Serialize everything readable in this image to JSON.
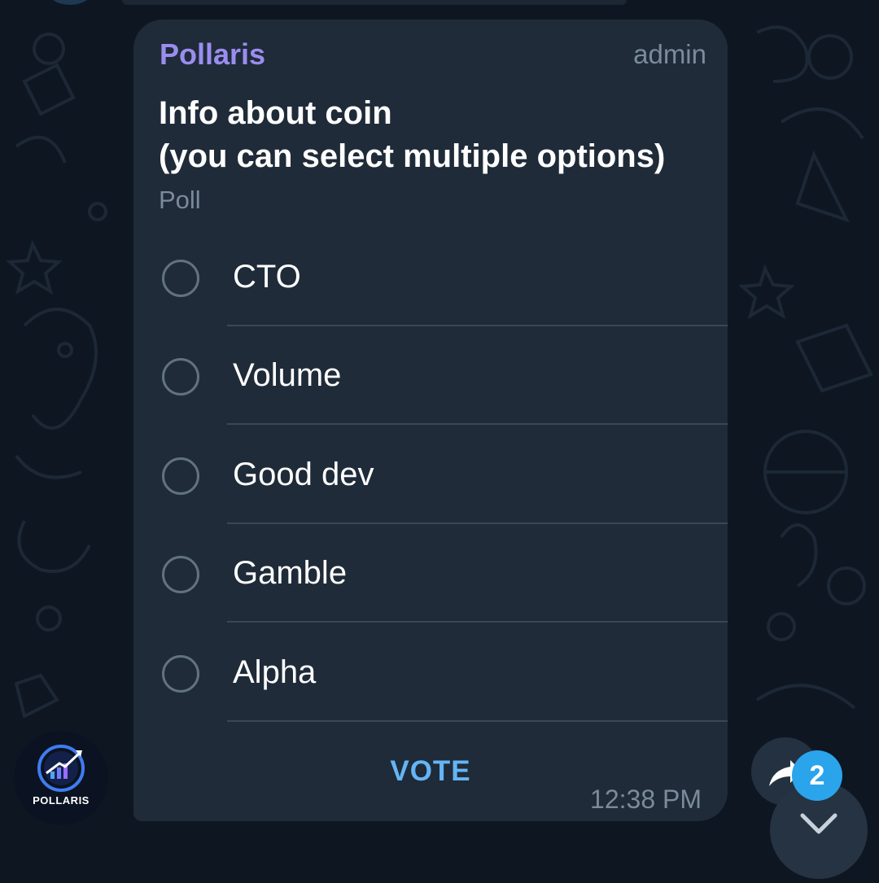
{
  "message": {
    "sender": "Pollaris",
    "role": "admin",
    "time": "12:38 PM"
  },
  "poll": {
    "question_line1": "Info about coin",
    "question_line2": "(you can select multiple options)",
    "type_label": "Poll",
    "options": [
      "CTO",
      "Volume",
      "Good dev",
      "Gamble",
      "Alpha"
    ],
    "vote_label": "VOTE"
  },
  "avatar": {
    "name": "POLLARIS"
  },
  "unread_count": "2",
  "icons": {
    "forward": "forward-arrow-icon",
    "scroll_down": "chevron-down-icon",
    "option_radio": "radio-unchecked-icon"
  },
  "colors": {
    "background": "#0e1621",
    "bubble": "#1f2b38",
    "sender": "#9a8df0",
    "accent": "#64b5f6",
    "badge": "#2aa4eb",
    "muted": "#7b8b9b"
  }
}
